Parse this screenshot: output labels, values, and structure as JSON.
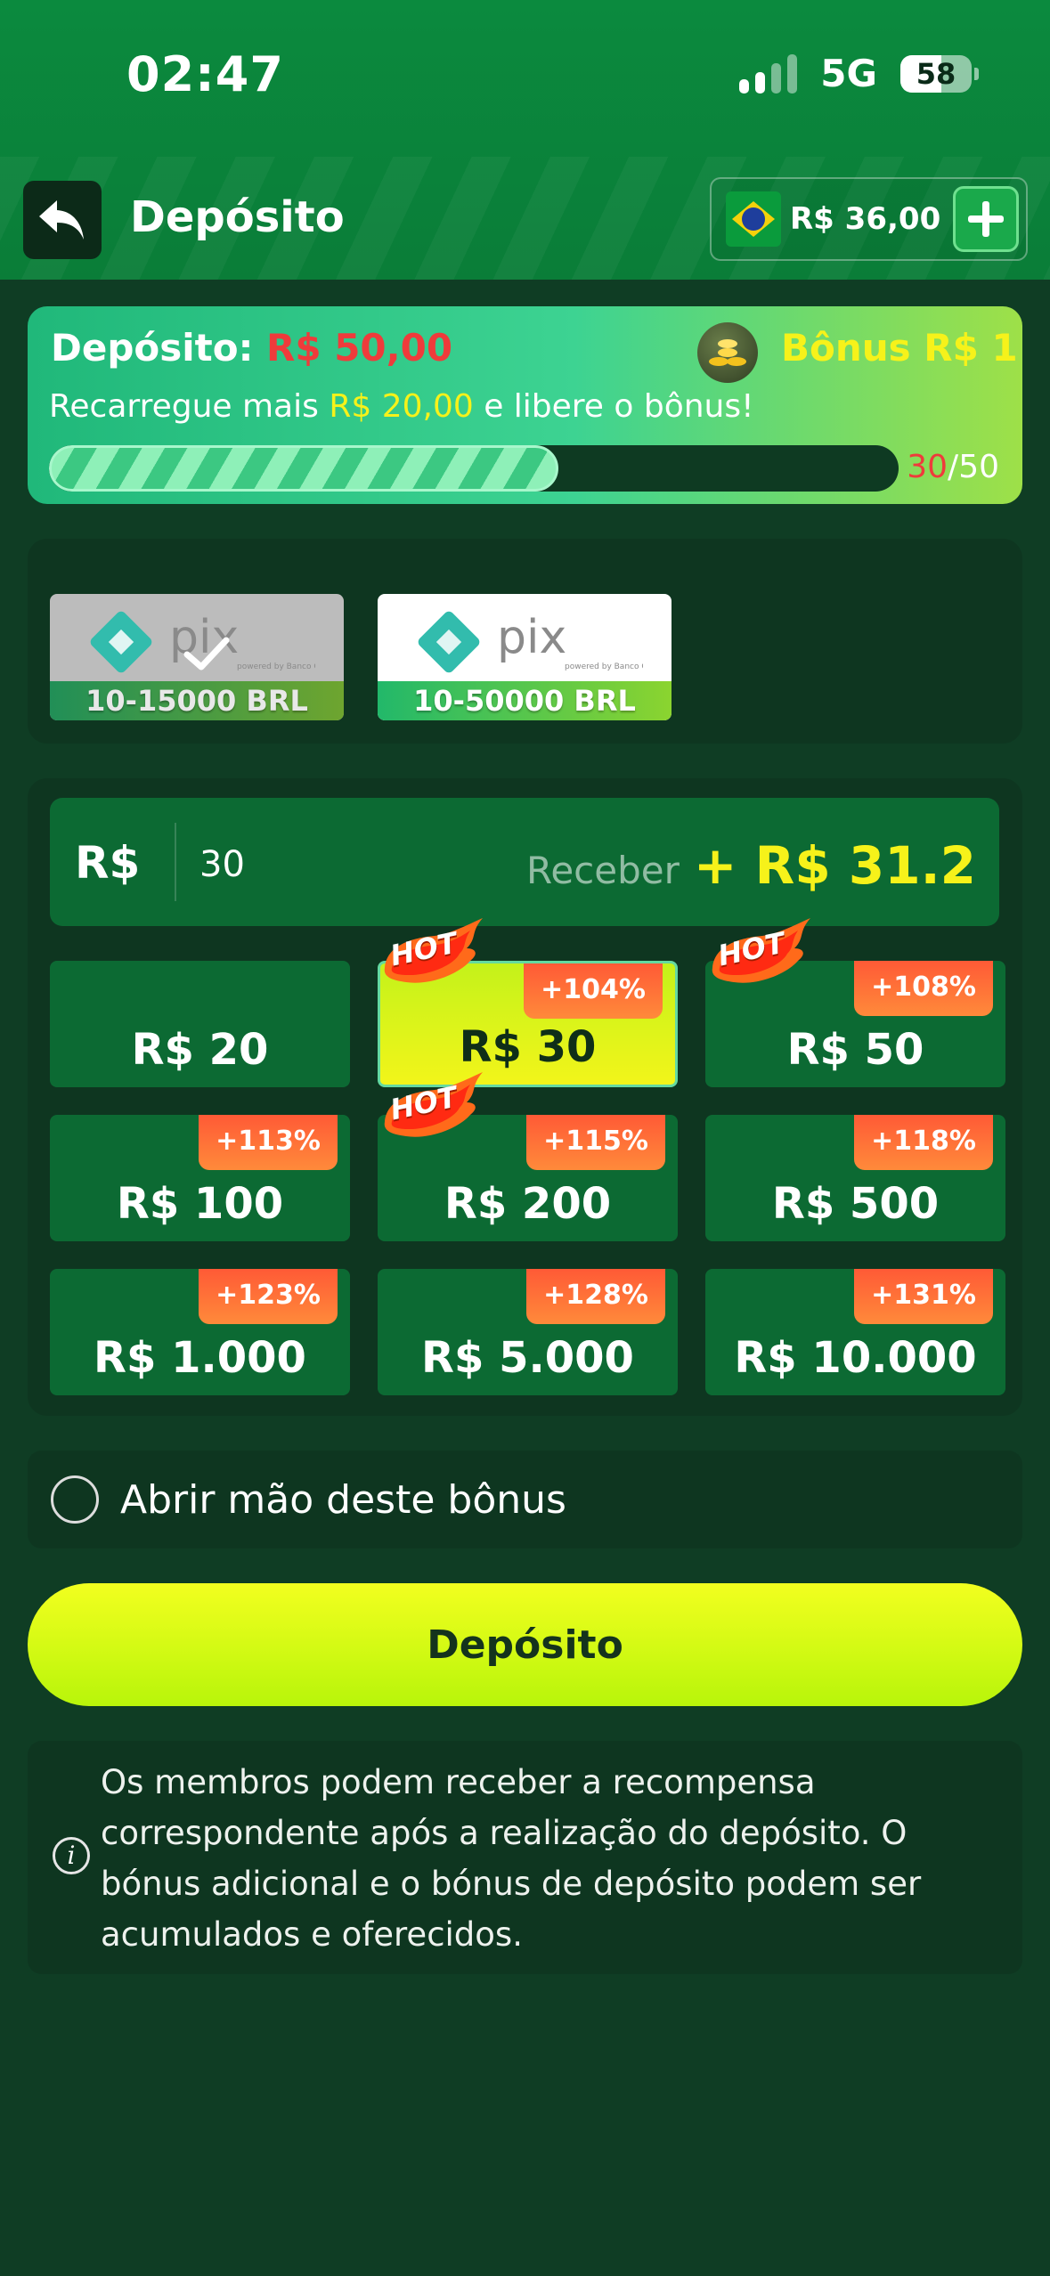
{
  "status_bar": {
    "time": "02:47",
    "network": "5G",
    "battery": "58"
  },
  "header": {
    "title": "Depósito",
    "balance": "R$ 36,00",
    "back_icon": "back-arrow-icon",
    "add_icon": "plus-icon"
  },
  "bonus_progress": {
    "deposit_label": "Depósito:",
    "deposit_value": "R$ 50,00",
    "bonus_label": "Bônus R$ 1",
    "message_prefix": "Recarregue mais ",
    "message_amount": "R$ 20,00",
    "message_suffix": " e libere o bônus!",
    "current": "30",
    "separator": "/",
    "target": "50",
    "progress_fraction": 0.6
  },
  "payment_methods": [
    {
      "name": "pix",
      "caption": "powered by Banco Central",
      "range": "10-15000 BRL",
      "selected": true
    },
    {
      "name": "pix",
      "caption": "powered by Banco Central",
      "range": "10-50000 BRL",
      "selected": false
    }
  ],
  "amount_input": {
    "currency": "R$",
    "value": "30",
    "receive_label": "Receber",
    "receive_value": "+ R$ 31.2"
  },
  "amount_options": [
    {
      "label": "R$ 20",
      "bonus": "",
      "hot": false,
      "selected": false
    },
    {
      "label": "R$ 30",
      "bonus": "+104%",
      "hot": true,
      "selected": true
    },
    {
      "label": "R$ 50",
      "bonus": "+108%",
      "hot": true,
      "selected": false
    },
    {
      "label": "R$ 100",
      "bonus": "+113%",
      "hot": false,
      "selected": false
    },
    {
      "label": "R$ 200",
      "bonus": "+115%",
      "hot": true,
      "selected": false
    },
    {
      "label": "R$ 500",
      "bonus": "+118%",
      "hot": false,
      "selected": false
    },
    {
      "label": "R$ 1.000",
      "bonus": "+123%",
      "hot": false,
      "selected": false
    },
    {
      "label": "R$ 5.000",
      "bonus": "+128%",
      "hot": false,
      "selected": false
    },
    {
      "label": "R$ 10.000",
      "bonus": "+131%",
      "hot": false,
      "selected": false
    }
  ],
  "hot_label": "HOT",
  "waive_bonus": {
    "label": "Abrir mão deste bônus",
    "checked": false
  },
  "deposit_button": {
    "label": "Depósito"
  },
  "info": {
    "icon": "info-icon",
    "text": "Os membros podem receber a recompensa correspondente após a realização do depósito. O bónus adicional e o bónus de depósito podem ser acumulados e oferecidos."
  },
  "colors": {
    "header_green": "#0b8a3e",
    "page_bg": "#0f3d24",
    "card_bg": "#0e3620",
    "tile_bg": "#0c6a33",
    "accent_yellow": "#f6f21a",
    "alert_red": "#ef3b3b",
    "badge_orange": "#ff6a36"
  }
}
